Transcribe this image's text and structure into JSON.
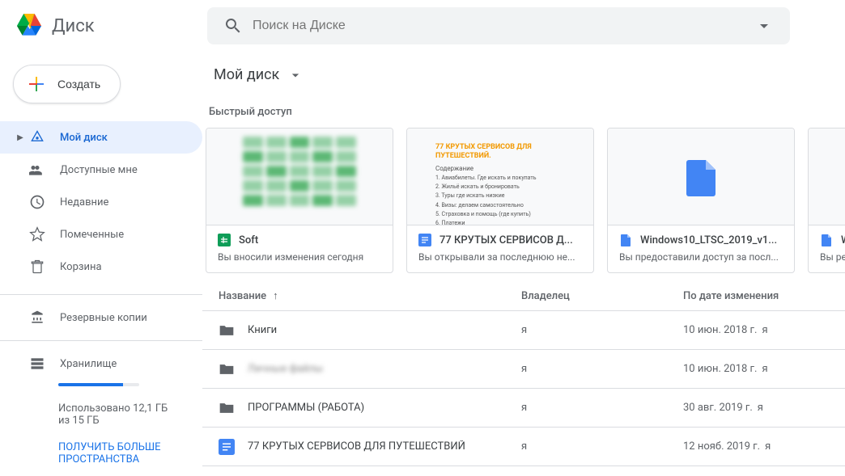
{
  "header": {
    "product_name": "Диск",
    "search_placeholder": "Поиск на Диске"
  },
  "sidebar": {
    "new_button": "Создать",
    "items": [
      {
        "label": "Мой диск",
        "icon": "drive",
        "active": true,
        "expandable": true
      },
      {
        "label": "Доступные мне",
        "icon": "shared",
        "active": false
      },
      {
        "label": "Недавние",
        "icon": "recent",
        "active": false
      },
      {
        "label": "Помеченные",
        "icon": "star",
        "active": false
      },
      {
        "label": "Корзина",
        "icon": "trash",
        "active": false
      }
    ],
    "backup_label": "Резервные копии",
    "storage_label": "Хранилище",
    "storage_usage": "Использовано 12,1 ГБ из 15 ГБ",
    "storage_cta": "ПОЛУЧИТЬ БОЛЬШЕ ПРОСТРАНСТВА"
  },
  "main": {
    "breadcrumb": "Мой диск",
    "quick_access_header": "Быстрый доступ",
    "quick_access": [
      {
        "title": "Soft",
        "subtitle": "Вы вносили изменения сегодня",
        "type": "sheet"
      },
      {
        "title": "77 КРУТЫХ СЕРВИСОВ Д...",
        "subtitle": "Вы открывали за последнюю не...",
        "type": "doc"
      },
      {
        "title": "Windows10_LTSC_2019_v1...",
        "subtitle": "Вы предоставили доступ за посл...",
        "type": "file"
      },
      {
        "title": "W",
        "subtitle": "Вы ре",
        "type": "file"
      }
    ],
    "columns": {
      "name": "Название",
      "owner": "Владелец",
      "modified": "По дате изменения"
    },
    "files": [
      {
        "name": "Книги",
        "owner": "я",
        "modified": "10 июн. 2018 г.",
        "by": "я",
        "type": "folder",
        "redacted": false
      },
      {
        "name": "Личные файлы",
        "owner": "я",
        "modified": "10 июн. 2018 г.",
        "by": "я",
        "type": "folder",
        "redacted": true
      },
      {
        "name": "ПРОГРАММЫ (РАБОТА)",
        "owner": "я",
        "modified": "30 авг. 2019 г.",
        "by": "я",
        "type": "folder",
        "redacted": false
      },
      {
        "name": "77 КРУТЫХ СЕРВИСОВ ДЛЯ ПУТЕШЕСТВИЙ",
        "owner": "я",
        "modified": "12 нояб. 2019 г.",
        "by": "я",
        "type": "doc",
        "redacted": false
      }
    ]
  }
}
